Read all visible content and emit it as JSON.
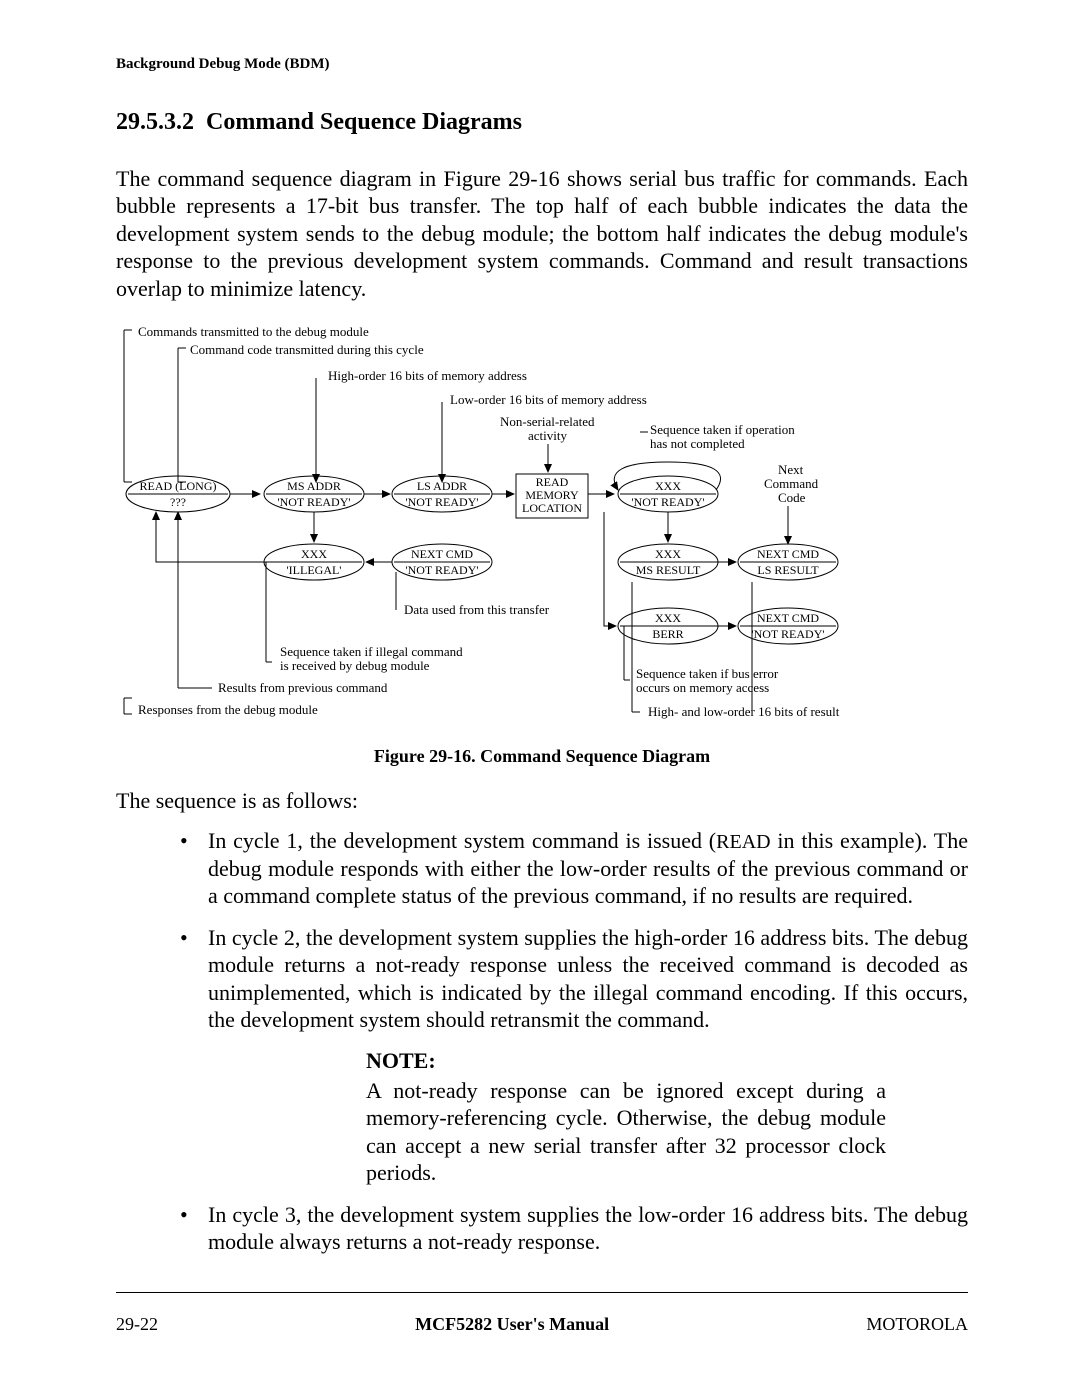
{
  "header": "Background Debug Mode (BDM)",
  "section": {
    "num": "29.5.3.2",
    "title": "Command Sequence Diagrams"
  },
  "para1": "The command sequence diagram in Figure 29-16 shows serial bus traffic for commands. Each bubble represents a 17-bit bus transfer. The top half of each bubble indicates the data the development system sends to the debug module; the bottom half indicates the debug module's response to the previous development system commands. Command and result transactions overlap to minimize latency.",
  "figure": {
    "caption": "Figure 29-16. Command Sequence Diagram",
    "labels": {
      "l_tx": "Commands transmitted to the debug module",
      "l_cmdcode": "Command code transmitted during this cycle",
      "l_hiaddr": "High-order 16 bits of memory address",
      "l_loaddr": "Low-order 16 bits of memory address",
      "l_nonser1": "Non-serial-related",
      "l_nonser2": "activity",
      "l_seqnc1": "Sequence taken if operation",
      "l_seqnc2": "has not completed",
      "l_nextcmd1": "Next",
      "l_nextcmd2": "Command",
      "l_nextcmd3": "Code",
      "l_datatr": "Data used from this transfer",
      "l_seqill1": "Sequence taken if illegal command",
      "l_seqill2": "is received by debug module",
      "l_resprev": "Results from previous command",
      "l_rx": "Responses from the debug module",
      "l_buserr1": "Sequence taken if bus error",
      "l_buserr2": "occurs on memory access",
      "l_hilores": "High- and low-order 16 bits of result"
    },
    "bubbles": {
      "b_read_t": "READ (LONG)",
      "b_read_b": "???",
      "b_ms_t": "MS ADDR",
      "b_ms_b": "'NOT READY'",
      "b_ls_t": "LS ADDR",
      "b_ls_b": "'NOT READY'",
      "b_mem_1": "READ",
      "b_mem_2": "MEMORY",
      "b_mem_3": "LOCATION",
      "b_xnr_t": "XXX",
      "b_xnr_b": "'NOT READY'",
      "b_ill_t": "XXX",
      "b_ill_b": "'ILLEGAL'",
      "b_nc1_t": "NEXT CMD",
      "b_nc1_b": "'NOT READY'",
      "b_xms_t": "XXX",
      "b_xms_b": "MS RESULT",
      "b_ncls_t": "NEXT CMD",
      "b_ncls_b": "LS RESULT",
      "b_berr_t": "XXX",
      "b_berr_b": "BERR",
      "b_ncnr_t": "NEXT CMD",
      "b_ncnr_b": "'NOT READY'"
    }
  },
  "after_fig": "The sequence is as follows:",
  "bullets": {
    "b1a": "In cycle 1, the development system command is issued (",
    "b1b": "READ",
    "b1c": " in this example). The debug module responds with either the low-order results of the previous command or a command complete status of the previous command, if no results are required.",
    "b2": "In cycle 2, the development system supplies the high-order 16 address bits. The debug module returns a not-ready response unless the received command is decoded as unimplemented, which is indicated by the illegal command encoding. If this occurs, the development system should retransmit the command.",
    "b3": "In cycle 3, the development system supplies the low-order 16 address bits. The debug module always returns a not-ready response."
  },
  "note": {
    "head": "NOTE:",
    "body": "A not-ready response can be ignored except during a memory-referencing cycle. Otherwise, the debug module can accept a new serial transfer after 32 processor clock periods."
  },
  "footer": {
    "left": "29-22",
    "mid": "MCF5282 User's Manual",
    "right": "MOTOROLA"
  }
}
